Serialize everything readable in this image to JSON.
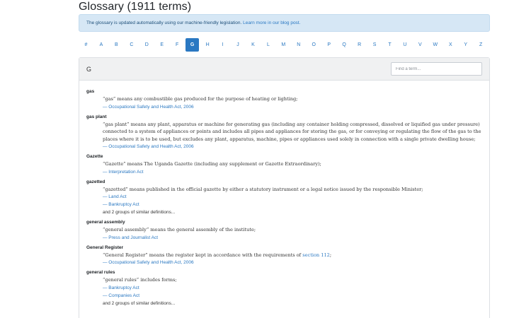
{
  "page": {
    "title": "Glossary (1911 terms)"
  },
  "alert": {
    "text": "The glossary is updated automatically using our machine-friendly legislation. ",
    "link": "Learn more in our blog post."
  },
  "letters": [
    "#",
    "A",
    "B",
    "C",
    "D",
    "E",
    "F",
    "G",
    "H",
    "I",
    "J",
    "K",
    "L",
    "M",
    "N",
    "O",
    "P",
    "Q",
    "R",
    "S",
    "T",
    "U",
    "V",
    "W",
    "X",
    "Y",
    "Z"
  ],
  "active_letter": "G",
  "card": {
    "heading": "G",
    "search_placeholder": "Find a term..."
  },
  "entries": [
    {
      "term": "gas",
      "definition_parts": [
        "“gas” means any combustible gas produced for the purpose of heating or lighting;"
      ],
      "sources": [
        "— Occupational Safety and Health Act, 2006"
      ],
      "more": ""
    },
    {
      "term": "gas plant",
      "definition_parts": [
        "“gas plant” means any plant, apparatus or machine for generating gas (including any container holding compressed, dissolved or liquified gas under pressure) connected to a system of appliances or points and includes all pipes and appliances for storing the gas, or for conveying or regulating the flow of the gas to the places where it is to be used, but excludes any plant, apparatus, machine, pipes or appliances used solely in connection with a single private dwelling house;"
      ],
      "sources": [
        "— Occupational Safety and Health Act, 2006"
      ],
      "more": ""
    },
    {
      "term": "Gazette",
      "definition_parts": [
        "“Gazette” means The Uganda Gazette (including any supplement or Gazette Extraordinary);"
      ],
      "sources": [
        "— Interpretation Act"
      ],
      "more": ""
    },
    {
      "term": "gazetted",
      "definition_parts": [
        "“gazetted” means published in the official gazette by either a statutory instrument or a legal notice issued by the responsible Minister;"
      ],
      "sources": [
        "— Land Act",
        "— Bankruptcy Act"
      ],
      "more": "and 2 groups of similar definitions..."
    },
    {
      "term": "general assembly",
      "definition_parts": [
        "“general assembly” means the general assembly of the institute;"
      ],
      "sources": [
        "— Press and Journalist Act"
      ],
      "more": ""
    },
    {
      "term": "General Register",
      "definition_parts": [
        "“General Register” means the register kept in accordance with the requirements of "
      ],
      "definition_link": "section 112",
      "definition_tail": ";",
      "sources": [
        "— Occupational Safety and Health Act, 2006"
      ],
      "more": ""
    },
    {
      "term": "general rules",
      "definition_parts": [
        "“general rules” includes forms;"
      ],
      "sources": [
        "— Bankruptcy Act",
        "— Companies Act"
      ],
      "more": "and 2 groups of similar definitions..."
    }
  ],
  "colors": {
    "accent": "#2a78c2",
    "alert_bg": "#d6e7f5",
    "header_bg": "#f0f1f2"
  }
}
